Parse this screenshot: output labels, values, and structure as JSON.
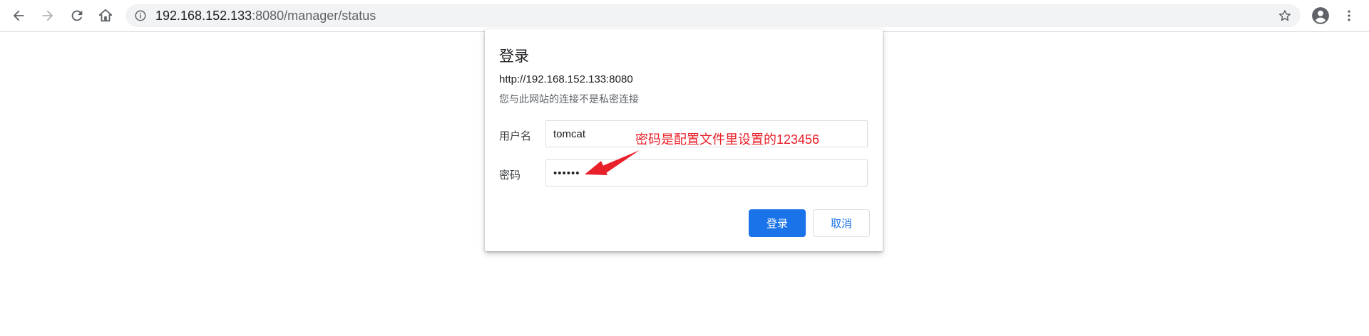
{
  "browser": {
    "address_bar": {
      "url_host": "192.168.152.133",
      "url_rest": ":8080/manager/status"
    },
    "icons": [
      "back-icon",
      "forward-icon",
      "reload-icon",
      "home-icon",
      "info-icon",
      "star-icon",
      "account-icon",
      "menu-icon"
    ]
  },
  "dialog": {
    "title": "登录",
    "origin": "http://192.168.152.133:8080",
    "warning": "您与此网站的连接不是私密连接",
    "username_label": "用户名",
    "username_value": "tomcat",
    "password_label": "密码",
    "password_masked": "••••••",
    "login_button": "登录",
    "cancel_button": "取消"
  },
  "annotation": {
    "text": "密码是配置文件里设置的123456",
    "color": "#e8202a"
  },
  "colors": {
    "accent": "#1a73e8",
    "omnibox_bg": "#f1f3f4"
  }
}
